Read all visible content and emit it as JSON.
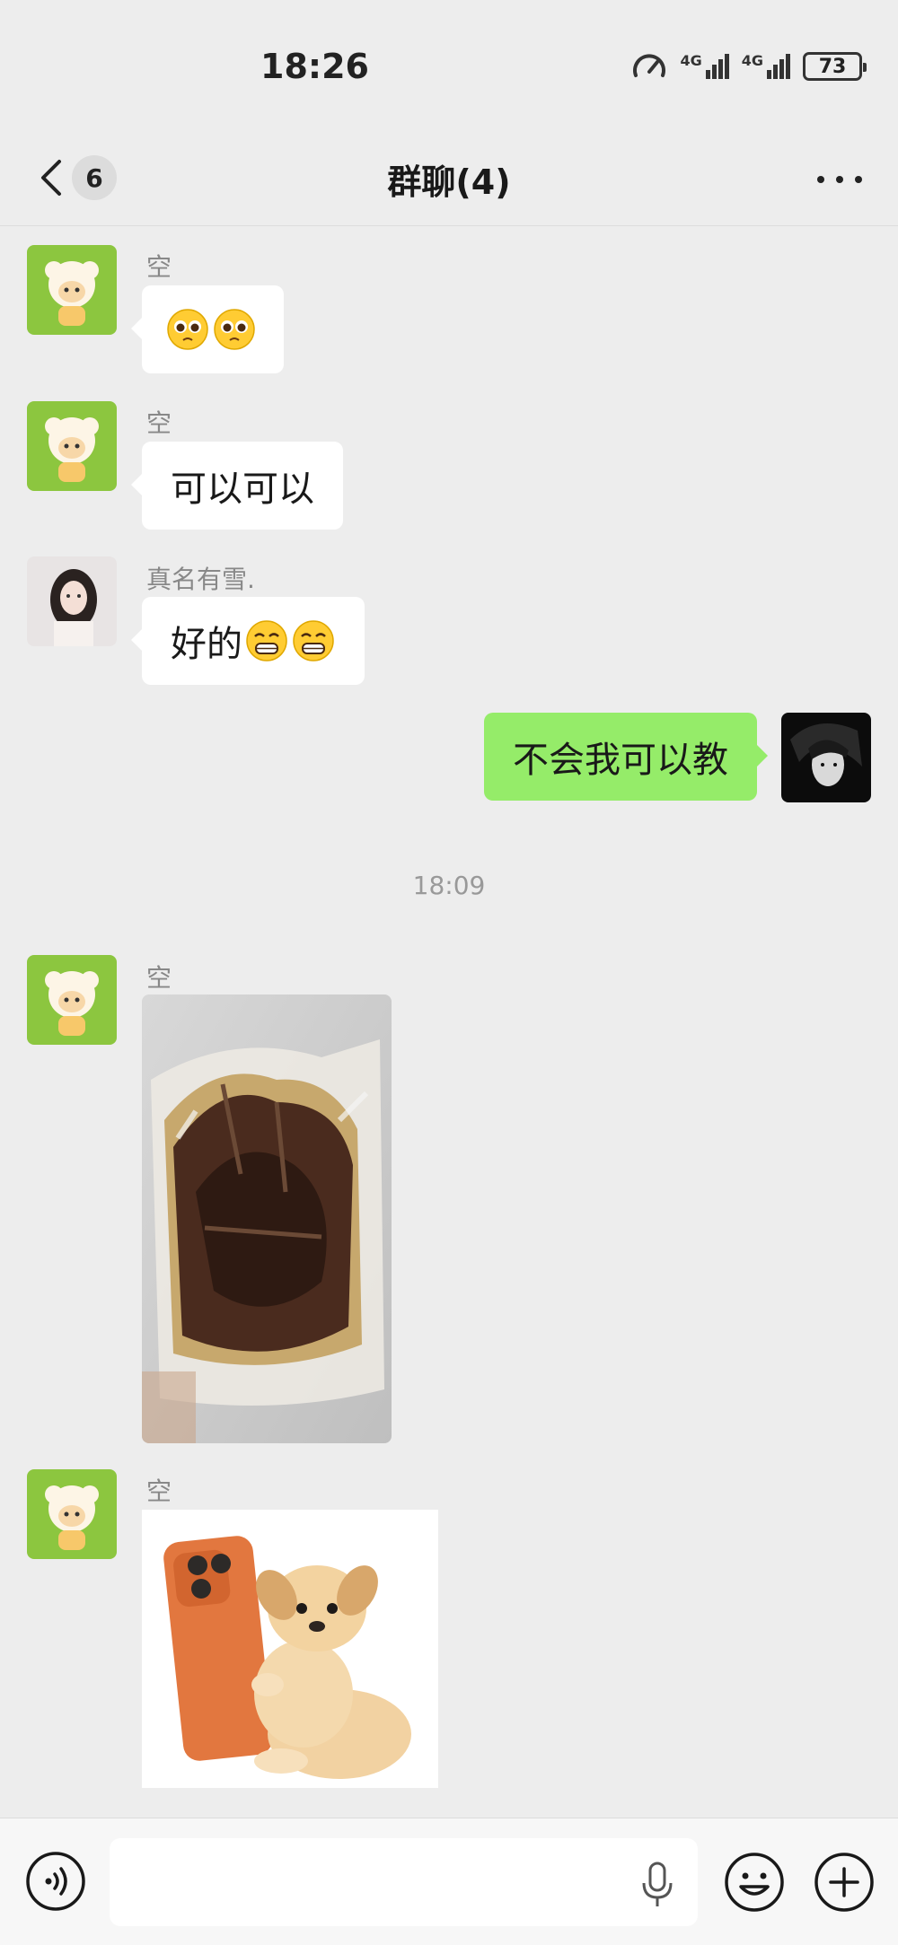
{
  "status_bar": {
    "time": "18:26",
    "network_1": "4G",
    "network_2": "4G",
    "battery": "73"
  },
  "header": {
    "unread_count": "6",
    "title": "群聊(4)"
  },
  "messages": [
    {
      "sender": "空",
      "type": "emoji",
      "content": "",
      "emoji_icons": [
        "pleading-face-icon",
        "pleading-face-icon"
      ]
    },
    {
      "sender": "空",
      "type": "text",
      "content": "可以可以"
    },
    {
      "sender": "真名有雪.",
      "type": "text",
      "content": "好的",
      "emoji_icons": [
        "grimacing-face-icon",
        "grimacing-face-icon"
      ]
    },
    {
      "sender": "me",
      "type": "text",
      "content": "不会我可以教"
    },
    {
      "type": "timestamp",
      "content": "18:09"
    },
    {
      "sender": "空",
      "type": "image",
      "image": "vacuum-packed-food-photo"
    },
    {
      "sender": "空",
      "type": "image",
      "image": "puppy-holding-orange-phone-sticker"
    }
  ],
  "colors": {
    "background": "#ededed",
    "sent_bubble": "#95ec69",
    "received_bubble": "#ffffff",
    "avatar_green": "#8cc63f"
  },
  "input_bar": {
    "placeholder": ""
  }
}
